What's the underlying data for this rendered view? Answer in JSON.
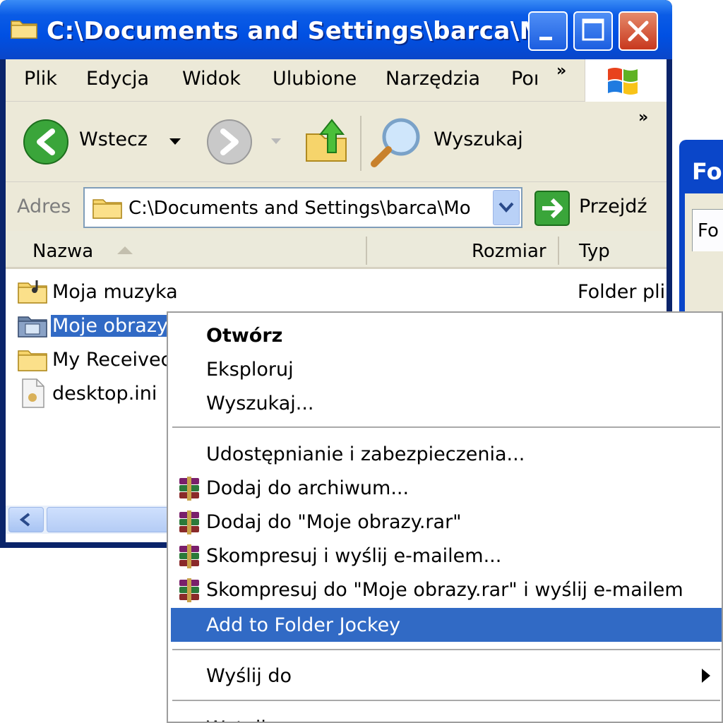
{
  "window": {
    "title": "C:\\Documents and Settings\\barca\\M…",
    "colors": {
      "titlebar": "#0054e3",
      "selection": "#316ac5",
      "chrome": "#ece9d8"
    }
  },
  "menubar": {
    "items": [
      "Plik",
      "Edycja",
      "Widok",
      "Ulubione",
      "Narzędzia",
      "Poı"
    ],
    "overflow": "»"
  },
  "toolbar": {
    "back_label": "Wstecz",
    "search_label": "Wyszukaj",
    "overflow": "»"
  },
  "address": {
    "label": "Adres",
    "value": "C:\\Documents and Settings\\barca\\Mo",
    "go_label": "Przejdź"
  },
  "filelist": {
    "columns": [
      "Nazwa",
      "Rozmiar",
      "Typ"
    ],
    "rows": [
      {
        "name": "Moja muzyka",
        "type": "Folder plil",
        "icon": "music-folder-icon"
      },
      {
        "name": "Moje obrazy",
        "type": "",
        "icon": "pictures-folder-icon",
        "selected": true
      },
      {
        "name": "My Receivec",
        "type": "",
        "icon": "folder-icon"
      },
      {
        "name": "desktop.ini",
        "type": "",
        "icon": "ini-file-icon"
      }
    ]
  },
  "background_window": {
    "title": "Fo",
    "tab_label": "Fo"
  },
  "context_menu": {
    "items": [
      {
        "label": "Otwórz",
        "bold": true
      },
      {
        "label": "Eksploruj"
      },
      {
        "label": "Wyszukaj..."
      },
      {
        "label": "Udostępnianie i zabezpieczenia..."
      },
      {
        "label": "Dodaj do archiwum...",
        "icon": "winrar-icon"
      },
      {
        "label": "Dodaj do \"Moje obrazy.rar\"",
        "icon": "winrar-icon"
      },
      {
        "label": "Skompresuj i wyślij e-mailem...",
        "icon": "winrar-icon"
      },
      {
        "label": "Skompresuj do \"Moje obrazy.rar\" i wyślij e-mailem",
        "icon": "winrar-icon"
      },
      {
        "label": "Add to Folder Jockey",
        "highlighted": true
      },
      {
        "label": "Wyślij do",
        "submenu": true
      },
      {
        "label": "Wytnij"
      }
    ]
  }
}
